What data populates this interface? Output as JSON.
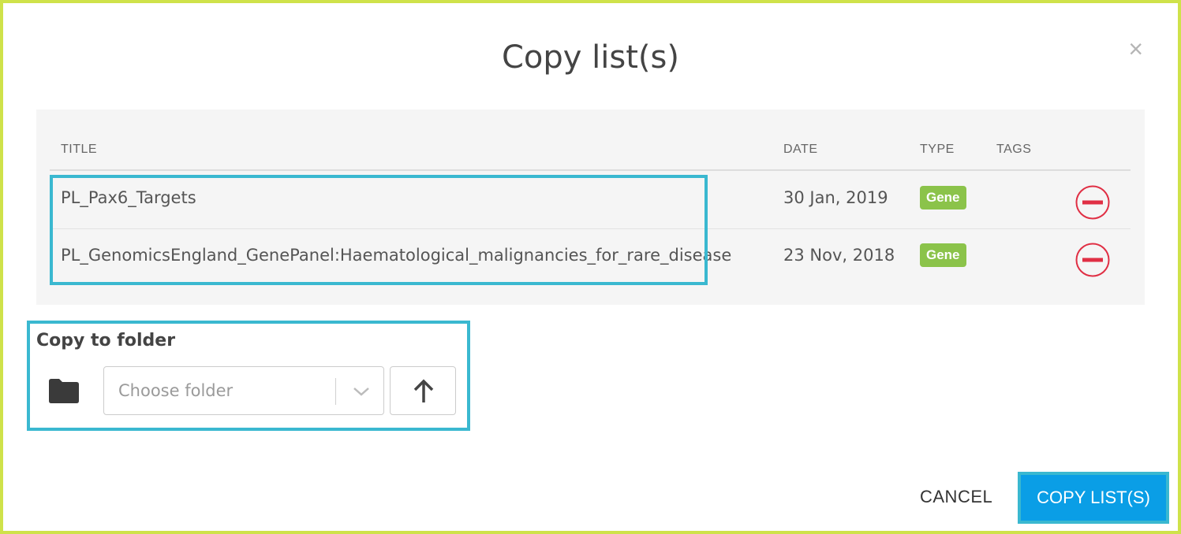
{
  "dialog": {
    "title": "Copy list(s)",
    "close_symbol": "×"
  },
  "table": {
    "columns": {
      "title": "TITLE",
      "date": "DATE",
      "type": "TYPE",
      "tags": "TAGS"
    },
    "rows": [
      {
        "title": "PL_Pax6_Targets",
        "date": "30 Jan, 2019",
        "type": "Gene",
        "action_icon": "remove-circle-icon"
      },
      {
        "title": "PL_GenomicsEngland_GenePanel:Haematological_malignancies_for_rare_disease",
        "date": "23 Nov, 2018",
        "type": "Gene",
        "action_icon": "remove-circle-icon"
      }
    ]
  },
  "folder": {
    "label": "Copy to folder",
    "icon": "folder-icon",
    "placeholder": "Choose folder",
    "up_icon": "arrow-up-icon"
  },
  "footer": {
    "cancel_label": "CANCEL",
    "confirm_label": "COPY LIST(S)"
  },
  "colors": {
    "frame": "#cfe24a",
    "highlight": "#3ab8d0",
    "badge": "#8bc34a",
    "remove": "#e02f44",
    "primary": "#0a9ee6"
  }
}
